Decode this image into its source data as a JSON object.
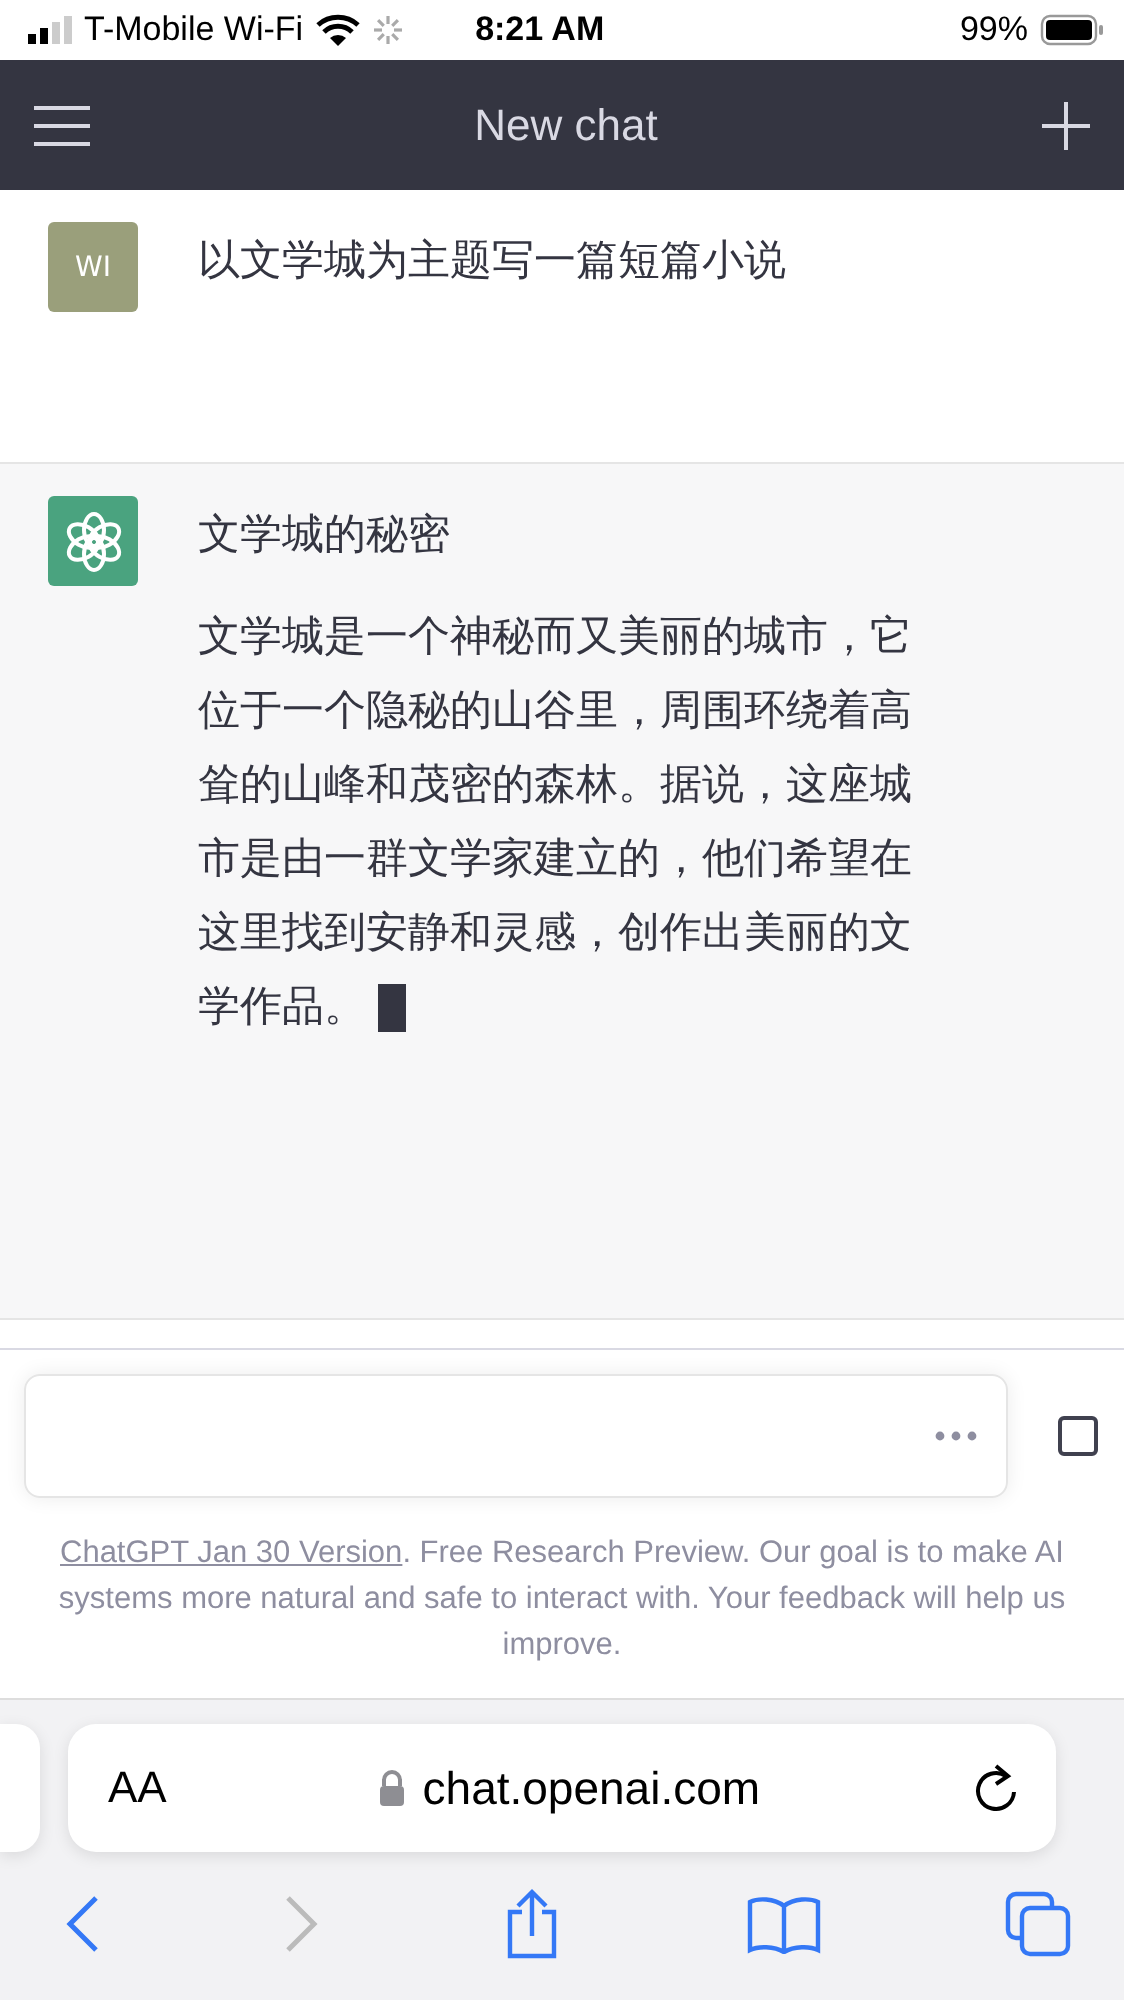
{
  "status_bar": {
    "carrier": "T-Mobile Wi-Fi",
    "time": "8:21 AM",
    "battery": "99%"
  },
  "header": {
    "title": "New chat"
  },
  "messages": [
    {
      "kind": "user",
      "avatar": "WI",
      "title": "以文学城为主题写一篇短篇小说"
    },
    {
      "kind": "assistant",
      "title": "文学城的秘密",
      "body": "文学城是一个神秘而又美丽的城市，它位于一个隐秘的山谷里，周围环绕着高耸的山峰和茂密的森林。据说，这座城市是由一群文学家建立的，他们希望在这里找到安静和灵感，创作出美丽的文学作品。",
      "streaming": true
    }
  ],
  "composer": {
    "loading": true
  },
  "footer": {
    "link": "ChatGPT Jan 30 Version",
    "text": ". Free Research Preview. Our goal is to make AI systems more natural and safe to interact with. Your feedback will help us improve."
  },
  "browser": {
    "text_size": "AA",
    "url": "chat.openai.com",
    "back_disabled": false,
    "forward_disabled": true
  }
}
